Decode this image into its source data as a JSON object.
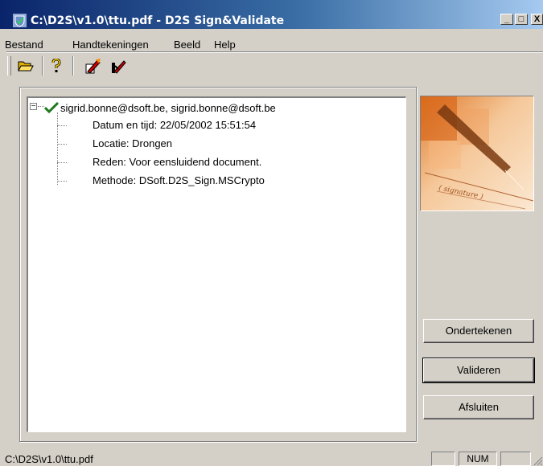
{
  "window": {
    "title": "C:\\D2S\\v1.0\\ttu.pdf - D2S Sign&Validate",
    "minimize": "_",
    "maximize": "□",
    "close": "X"
  },
  "menu": [
    "Bestand",
    "Handtekeningen",
    "Beeld",
    "Help"
  ],
  "toolbar": {
    "icons": [
      "open-folder-icon",
      "help-icon",
      "sign-pen-icon",
      "validate-pen-icon"
    ]
  },
  "tree": {
    "root": "sigrid.bonne@dsoft.be, sigrid.bonne@dsoft.be",
    "expander": "−",
    "children": [
      "Datum en tijd: 22/05/2002 15:51:54",
      "Locatie: Drongen",
      "Reden: Voor eensluidend document.",
      "Methode: DSoft.D2S_Sign.MSCrypto"
    ]
  },
  "image": {
    "signature_text": "( signature )"
  },
  "buttons": {
    "sign": "Ondertekenen",
    "validate": "Valideren",
    "close": "Afsluiten"
  },
  "status": {
    "path": "C:\\D2S\\v1.0\\ttu.pdf",
    "num": "NUM"
  },
  "colors": {
    "checkmark": "#1f7a1f",
    "titlebar": "#0a246a"
  }
}
